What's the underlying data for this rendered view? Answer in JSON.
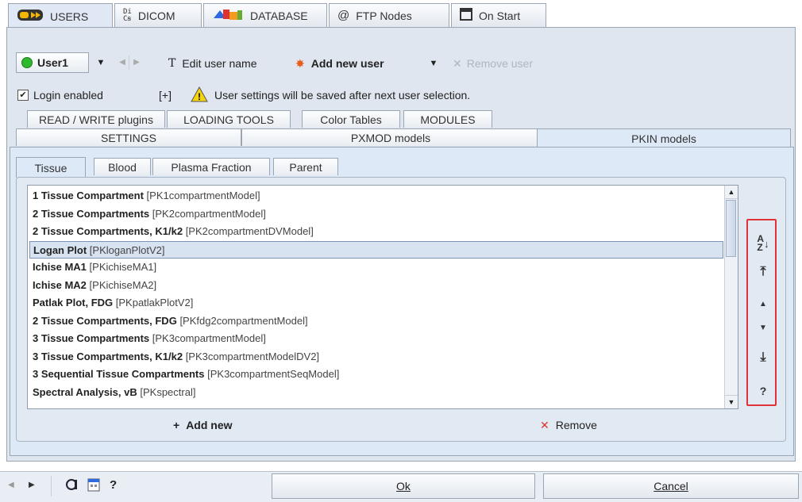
{
  "top_tabs": [
    {
      "label": "USERS",
      "icon": "users-icon"
    },
    {
      "label": "DICOM",
      "icon": "dicom-icon"
    },
    {
      "label": "DATABASE",
      "icon": "database-icon"
    },
    {
      "label": "FTP Nodes",
      "icon": "at-icon"
    },
    {
      "label": "On Start",
      "icon": "window-icon"
    }
  ],
  "user_bar": {
    "user_name": "User1",
    "edit_label": "Edit user name",
    "add_label": "Add new user",
    "remove_label": "Remove user"
  },
  "login": {
    "checkbox_label": "Login enabled",
    "expand_label": "[+]",
    "warning_text": "User settings will be saved after next user selection."
  },
  "config_tabs_row1": [
    "READ / WRITE plugins",
    "LOADING TOOLS",
    "Color Tables",
    "MODULES"
  ],
  "config_tabs_row2": [
    "SETTINGS",
    "PXMOD models",
    "PKIN models"
  ],
  "model_tabs": [
    "Tissue",
    "Blood",
    "Plasma Fraction",
    "Parent"
  ],
  "models": [
    {
      "name": "1 Tissue Compartment",
      "id": "[PK1compartmentModel]"
    },
    {
      "name": "2 Tissue Compartments",
      "id": "[PK2compartmentModel]"
    },
    {
      "name": "2 Tissue Compartments, K1/k2",
      "id": "[PK2compartmentDVModel]"
    },
    {
      "name": "Logan Plot",
      "id": "[PKloganPlotV2]"
    },
    {
      "name": "Ichise MA1",
      "id": "[PKichiseMA1]"
    },
    {
      "name": "Ichise MA2",
      "id": "[PKichiseMA2]"
    },
    {
      "name": "Patlak Plot, FDG",
      "id": "[PKpatlakPlotV2]"
    },
    {
      "name": "2 Tissue Compartments, FDG",
      "id": "[PKfdg2compartmentModel]"
    },
    {
      "name": "3 Tissue Compartments",
      "id": "[PK3compartmentModel]"
    },
    {
      "name": "3 Tissue Compartments, K1/k2",
      "id": "[PK3compartmentModelDV2]"
    },
    {
      "name": "3 Sequential Tissue Compartments",
      "id": "[PK3compartmentSeqModel]"
    },
    {
      "name": "Spectral Analysis, vB",
      "id": "[PKspectral]"
    }
  ],
  "selected_model": "Logan Plot",
  "list_actions": {
    "add_label": "Add new",
    "remove_label": "Remove"
  },
  "footer": {
    "ok_label": "Ok",
    "cancel_label": "Cancel",
    "help_label": "?"
  },
  "colors": {
    "highlight_border": "#e0323a",
    "selection": "#d8e3f2",
    "accent_green": "#2eb82e"
  }
}
